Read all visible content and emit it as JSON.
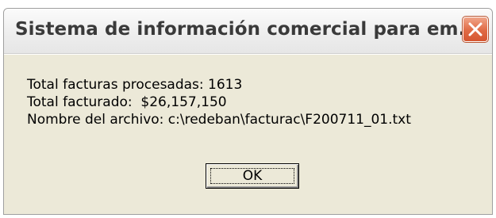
{
  "window": {
    "title": "Sistema de información comercial para em...",
    "close_icon": "close-icon"
  },
  "message": {
    "line1": "Total facturas procesadas: 1613",
    "line2": "Total facturado:  $26,157,150",
    "line3": "Nombre del archivo: c:\\redeban\\facturac\\F200711_01.txt"
  },
  "buttons": {
    "ok_label": "OK"
  },
  "colors": {
    "close_button": "#e06a44",
    "dialog_background": "#ece9d8"
  }
}
